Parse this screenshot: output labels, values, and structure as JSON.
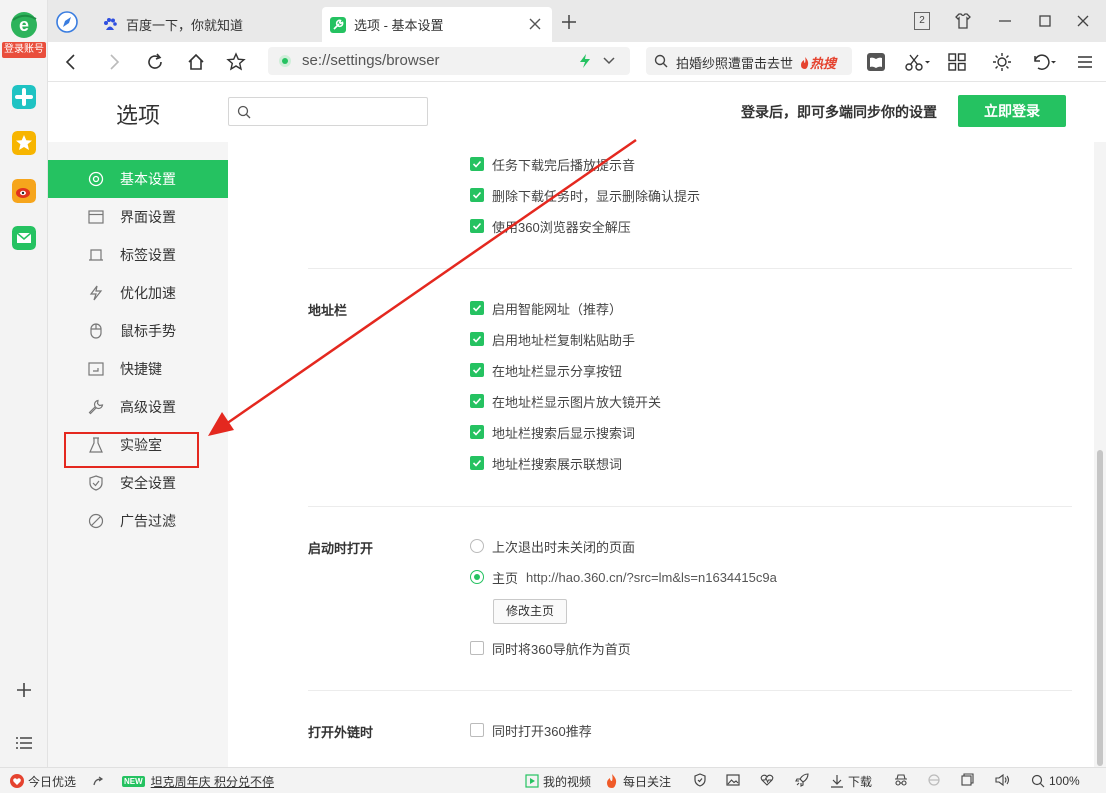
{
  "rail": {
    "login_tag": "登录账号"
  },
  "tabs": [
    {
      "title": "百度一下，你就知道"
    },
    {
      "title": "选项 - 基本设置"
    }
  ],
  "window": {
    "tab_count": "2"
  },
  "address_bar": {
    "url": "se://settings/browser"
  },
  "search_bar": {
    "query": "拍婚纱照遭雷击去世",
    "hot_label": "热搜"
  },
  "header": {
    "title": "选项",
    "search_placeholder": "",
    "sync_text": "登录后，即可多端同步你的设置",
    "login_button": "立即登录"
  },
  "nav": {
    "items": [
      {
        "label": "基本设置",
        "icon": "gear-circle-icon",
        "active": true
      },
      {
        "label": "界面设置",
        "icon": "window-icon",
        "active": false
      },
      {
        "label": "标签设置",
        "icon": "tab-icon",
        "active": false
      },
      {
        "label": "优化加速",
        "icon": "lightning-icon",
        "active": false
      },
      {
        "label": "鼠标手势",
        "icon": "mouse-icon",
        "active": false
      },
      {
        "label": "快捷键",
        "icon": "keyboard-icon",
        "active": false
      },
      {
        "label": "高级设置",
        "icon": "wrench-icon",
        "active": false
      },
      {
        "label": "实验室",
        "icon": "flask-icon",
        "active": false
      },
      {
        "label": "安全设置",
        "icon": "shield-icon",
        "active": false
      },
      {
        "label": "广告过滤",
        "icon": "block-icon",
        "active": false
      }
    ]
  },
  "content": {
    "download_options": [
      {
        "label": "任务下载完后播放提示音",
        "checked": true
      },
      {
        "label": "删除下载任务时，显示删除确认提示",
        "checked": true
      },
      {
        "label": "使用360浏览器安全解压",
        "checked": true
      }
    ],
    "address_bar_section": {
      "title": "地址栏",
      "options": [
        {
          "label": "启用智能网址（推荐）",
          "checked": true
        },
        {
          "label": "启用地址栏复制粘贴助手",
          "checked": true
        },
        {
          "label": "在地址栏显示分享按钮",
          "checked": true
        },
        {
          "label": "在地址栏显示图片放大镜开关",
          "checked": true
        },
        {
          "label": "地址栏搜索后显示搜索词",
          "checked": true
        },
        {
          "label": "地址栏搜索展示联想词",
          "checked": true
        }
      ]
    },
    "startup_section": {
      "title": "启动时打开",
      "radio_last": "上次退出时未关闭的页面",
      "radio_home": "主页",
      "home_url": "http://hao.360.cn/?src=lm&ls=n1634415c9a",
      "edit_button": "修改主页",
      "nav_home_option": "同时将360导航作为首页",
      "selected": "home"
    },
    "external_link_section": {
      "title": "打开外链时",
      "option": "同时打开360推荐"
    }
  },
  "status_bar": {
    "daily_picks": "今日优选",
    "new_badge": "NEW",
    "promo": "坦克周年庆 积分兑不停",
    "my_videos": "我的视频",
    "daily_follow": "每日关注",
    "download": "下载",
    "zoom": "100%"
  },
  "colors": {
    "accent": "#25c261",
    "annotation_red": "#e4281f"
  }
}
